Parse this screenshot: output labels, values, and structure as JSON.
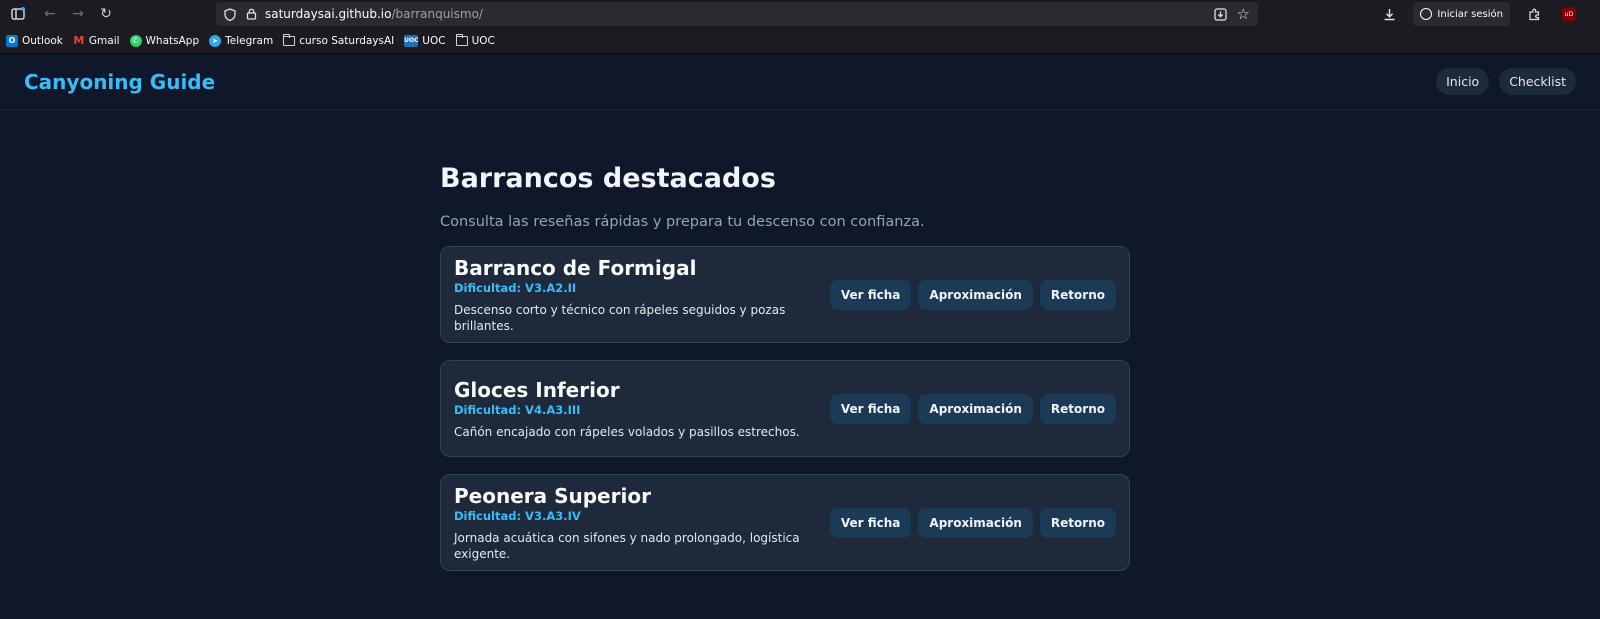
{
  "browser": {
    "url_host": "saturdaysai.github.io",
    "url_path": "/barranquismo/",
    "signin_label": "Iniciar sesión",
    "ublock_badge": "uD",
    "bookmarks": [
      {
        "label": "Outlook",
        "icon": "outlook-icon",
        "color": "#0078d4",
        "glyph": "O"
      },
      {
        "label": "Gmail",
        "icon": "gmail-icon",
        "color": "#ea4335",
        "glyph": "M"
      },
      {
        "label": "WhatsApp",
        "icon": "whatsapp-icon",
        "color": "#25d366",
        "glyph": "✆"
      },
      {
        "label": "Telegram",
        "icon": "telegram-icon",
        "color": "#2aabee",
        "glyph": "➤"
      },
      {
        "label": "curso SaturdaysAI",
        "icon": "folder-icon"
      },
      {
        "label": "UOC",
        "icon": "uoc-icon",
        "color": "#1f6fb2",
        "glyph": "U"
      },
      {
        "label": "UOC",
        "icon": "folder-icon"
      }
    ]
  },
  "header": {
    "brand": "Canyoning Guide",
    "nav": [
      {
        "label": "Inicio"
      },
      {
        "label": "Checklist"
      }
    ]
  },
  "main": {
    "title": "Barrancos destacados",
    "subtitle": "Consulta las reseñas rápidas y prepara tu descenso con confianza.",
    "canyons": [
      {
        "name": "Barranco de Formigal",
        "difficulty": "Dificultad: V3.A2.II",
        "description": "Descenso corto y técnico con rápeles seguidos y pozas brillantes."
      },
      {
        "name": "Gloces Inferior",
        "difficulty": "Dificultad: V4.A3.III",
        "description": "Cañón encajado con rápeles volados y pasillos estrechos."
      },
      {
        "name": "Peonera Superior",
        "difficulty": "Dificultad: V3.A3.IV",
        "description": "Jornada acuática con sifones y nado prolongado, logística exigente."
      }
    ],
    "actions": {
      "view": "Ver ficha",
      "approach": "Aproximación",
      "return": "Retorno"
    }
  },
  "colors": {
    "background": "#0f172a",
    "card": "#1e293b",
    "accent": "#38bdf8",
    "button": "#1a3a56"
  }
}
